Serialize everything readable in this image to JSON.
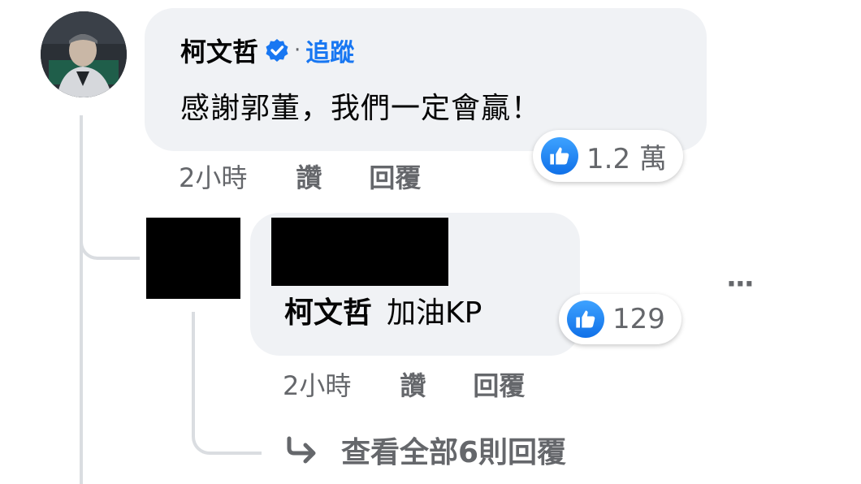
{
  "comment": {
    "author": "柯文哲",
    "separator": "·",
    "follow_label": "追蹤",
    "text": "感謝郭董，我們一定會贏！",
    "time": "2小時",
    "like_label": "讚",
    "reply_label": "回覆",
    "reaction_count": "1.2 萬"
  },
  "reply": {
    "mention": "柯文哲",
    "text": "加油KP",
    "time": "2小時",
    "like_label": "讚",
    "reply_label": "回覆",
    "reaction_count": "129",
    "more_label": "···"
  },
  "view_all_replies": "查看全部6則回覆",
  "colors": {
    "bubble": "#f0f2f5",
    "link_blue": "#1877f2",
    "meta_gray": "#65676b",
    "connector": "#dadde1"
  },
  "icons": [
    "verified-badge-icon",
    "like-thumb-icon",
    "reply-arrow-icon",
    "more-options-icon"
  ]
}
